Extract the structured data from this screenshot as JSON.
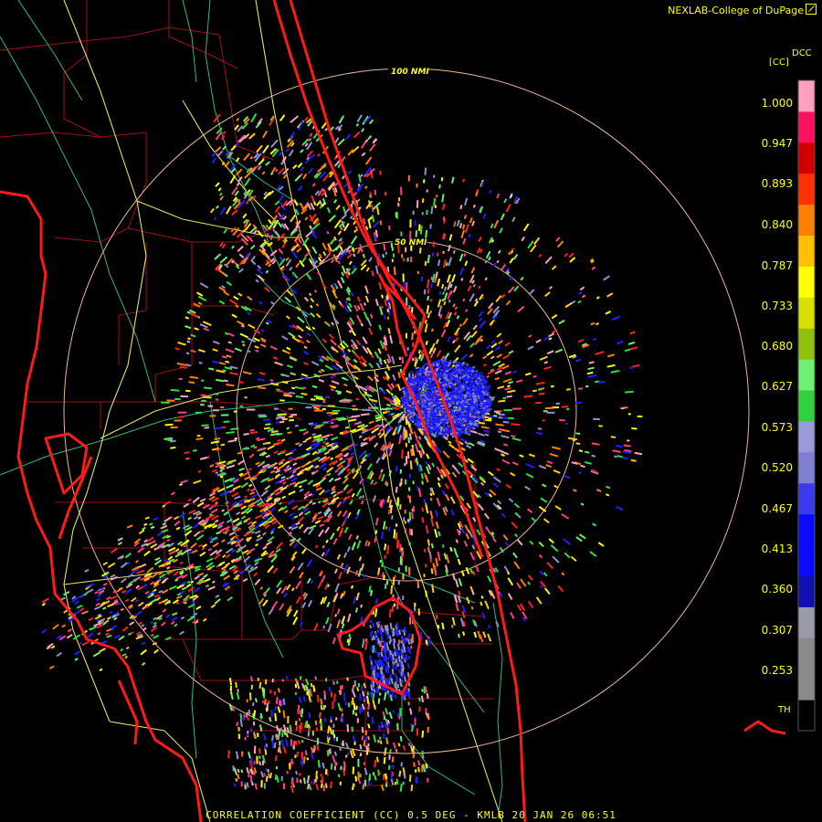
{
  "header": {
    "brand": "NEXLAB-College of DuPage",
    "logo": "cod-logo-icon"
  },
  "footer": {
    "title": "CORRELATION COEFFICIENT (CC) 0.5 DEG - KMLB 20 JAN 26 06:51"
  },
  "map": {
    "radar_site": "KMLB",
    "range_rings": [
      {
        "label": "100 NMI",
        "range_nmi": 100
      },
      {
        "label": "50 NMI",
        "range_nmi": 50
      }
    ],
    "colors": {
      "background": "#000000",
      "coastline": "#ff1a1a",
      "county_lines": "#a01010",
      "highways": "#e8e060",
      "rivers_roads": "#2fb880",
      "range_rings": "#e8b890"
    }
  },
  "legend": {
    "product": "DCC",
    "unit": "[CC]",
    "labels": [
      "1.000",
      "0.947",
      "0.893",
      "0.840",
      "0.787",
      "0.733",
      "0.680",
      "0.627",
      "0.573",
      "0.520",
      "0.467",
      "0.413",
      "0.360",
      "0.307",
      "0.253"
    ],
    "threshold_label": "TH",
    "scale_min": 0.2,
    "scale_max": 1.05,
    "colors": [
      "#000000",
      "#8a8a8a",
      "#8a8a8a",
      "#9a9aa8",
      "#1010b0",
      "#0a0aff",
      "#0a0aff",
      "#3a3aee",
      "#8080d0",
      "#9a9ad8",
      "#30d040",
      "#70f070",
      "#90c010",
      "#d8e000",
      "#ffff00",
      "#ffc000",
      "#ff8000",
      "#ff3000",
      "#d00000",
      "#ff1060",
      "#ffa0c0"
    ]
  }
}
